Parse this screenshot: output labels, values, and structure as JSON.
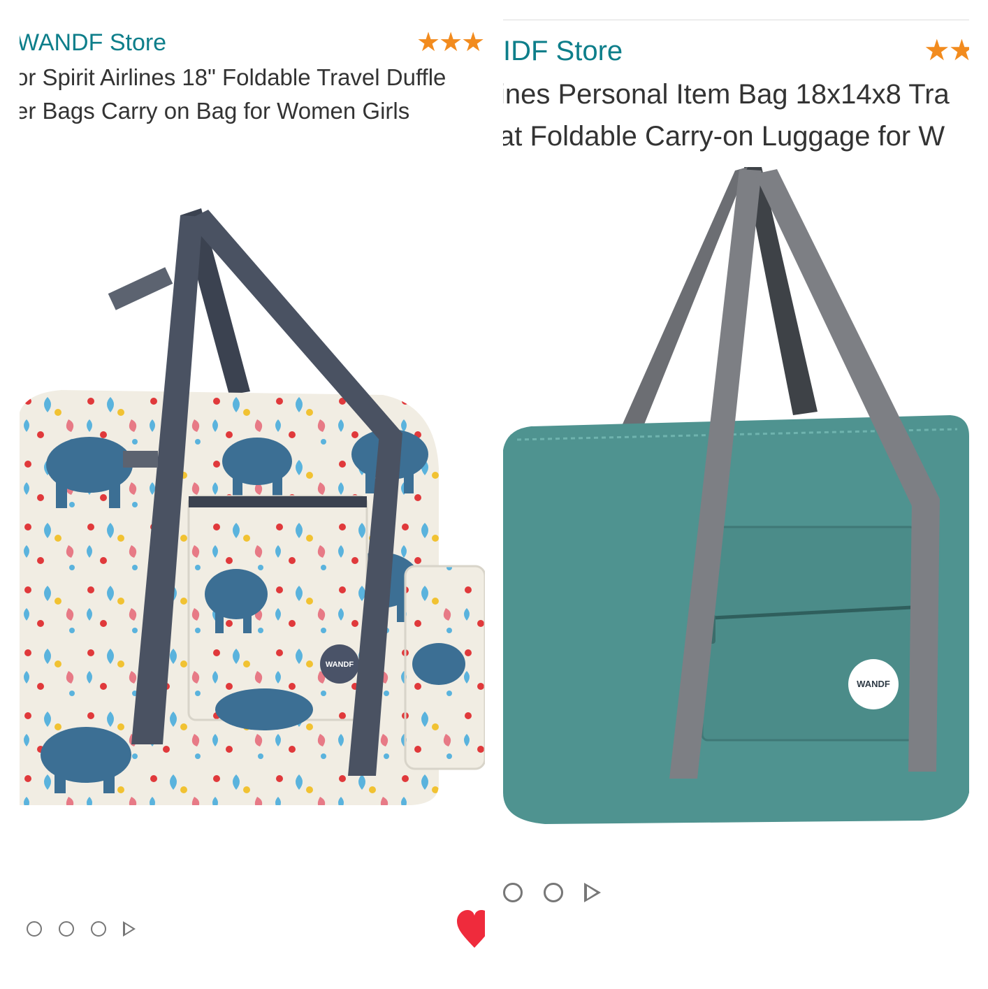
{
  "cards": [
    {
      "store_name": "WANDF Store",
      "title_line_1": "or Spirit Airlines 18\" Foldable Travel Duffle",
      "title_line_2": "er Bags Carry on Bag for Women Girls",
      "stars_display": "★★★",
      "image_alt": "Elephant floral print foldable duffle bag with pouch",
      "badge_text": "WANDF",
      "carousel_dots": 3,
      "favorite": true,
      "colors": {
        "bag": "#f1ede3",
        "straps": "#4a5262",
        "elephant": "#3c6f94",
        "heart": "#ef2b3c"
      }
    },
    {
      "store_name": "IDF Store",
      "title_line_1": "ines Personal Item Bag 18x14x8 Tra",
      "title_line_2": "at Foldable Carry-on Luggage for W",
      "stars_display": "★★",
      "image_alt": "Teal foldable carry-on duffle bag with gray straps",
      "badge_text": "WANDF",
      "carousel_dots": 2,
      "colors": {
        "bag": "#4f9390",
        "straps": "#7d7f84"
      }
    }
  ]
}
